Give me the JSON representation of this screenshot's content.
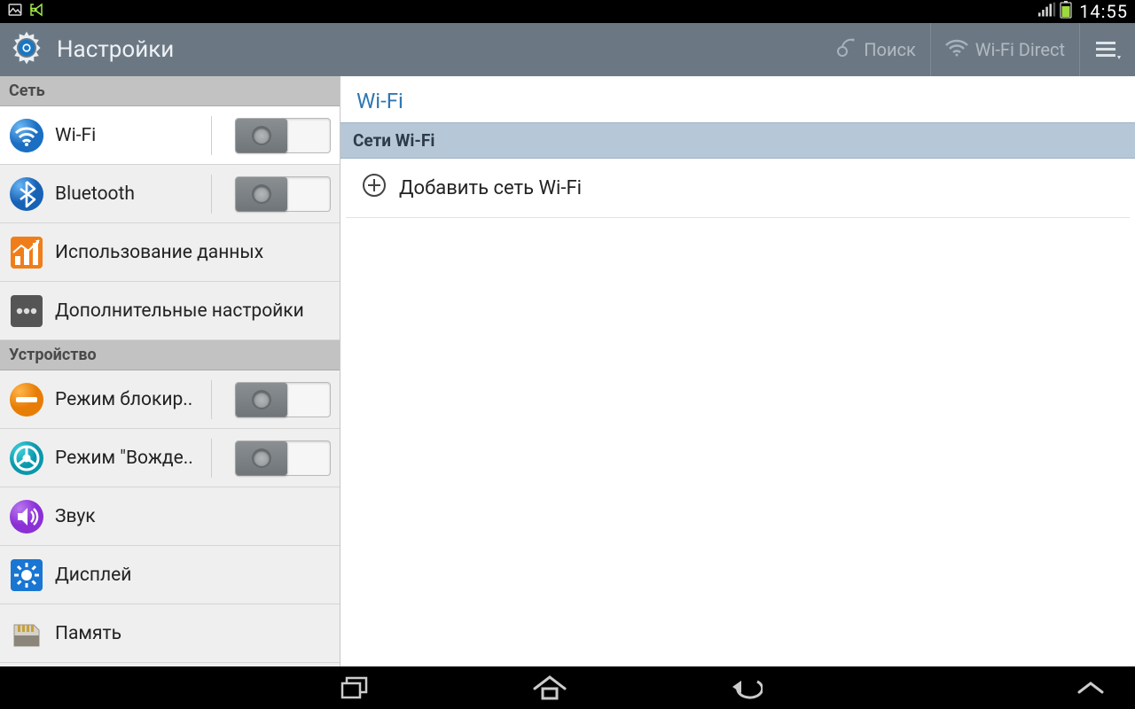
{
  "status": {
    "time": "14:55"
  },
  "actionbar": {
    "title": "Настройки",
    "search_label": "Поиск",
    "wifidirect_label": "Wi-Fi Direct"
  },
  "sidebar": {
    "section_network": "Сеть",
    "section_device": "Устройство",
    "wifi_label": "Wi-Fi",
    "bluetooth_label": "Bluetooth",
    "datausage_label": "Использование данных",
    "more_label": "Дополнительные настройки",
    "blocking_label": "Режим блокир..",
    "driving_label": "Режим \"Вожде..",
    "sound_label": "Звук",
    "display_label": "Дисплей",
    "storage_label": "Память"
  },
  "detail": {
    "title": "Wi-Fi",
    "networks_header": "Сети Wi-Fi",
    "add_network_label": "Добавить сеть Wi-Fi"
  }
}
